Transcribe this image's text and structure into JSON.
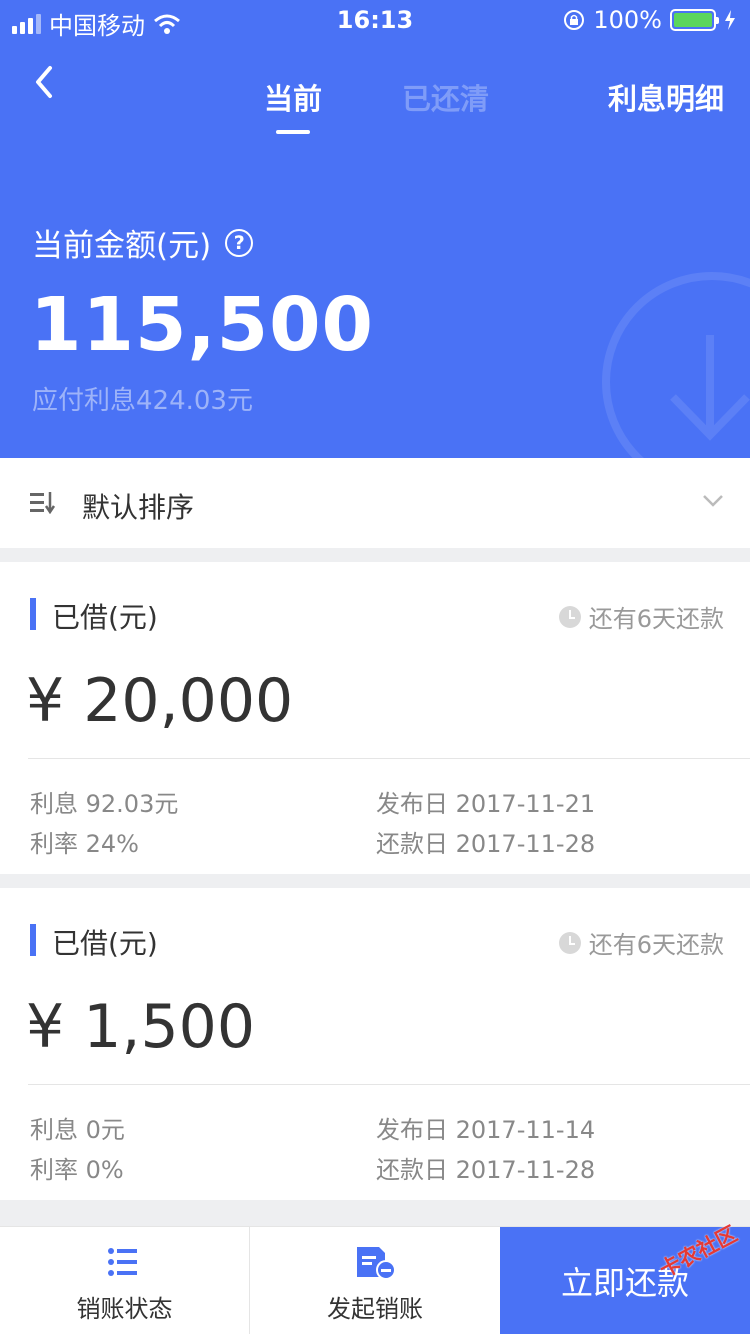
{
  "status_bar": {
    "carrier": "中国移动",
    "time": "16:13",
    "battery": "100%"
  },
  "nav": {
    "tabs": [
      "当前",
      "已还清"
    ],
    "right_label": "利息明细"
  },
  "summary": {
    "label": "当前金额(元)",
    "help_icon": "?",
    "amount": "115,500",
    "interest_due": "应付利息424.03元"
  },
  "sort": {
    "label": "默认排序"
  },
  "loans": [
    {
      "title": "已借(元)",
      "due": "还有6天还款",
      "amount": "¥ 20,000",
      "interest": "利息 92.03元",
      "rate": "利率 24%",
      "publish_date": "发布日 2017-11-21",
      "repay_date": "还款日 2017-11-28"
    },
    {
      "title": "已借(元)",
      "due": "还有6天还款",
      "amount": "¥ 1,500",
      "interest": "利息 0元",
      "rate": "利率 0%",
      "publish_date": "发布日 2017-11-14",
      "repay_date": "还款日 2017-11-28"
    }
  ],
  "bottom": {
    "status_label": "销账状态",
    "initiate_label": "发起销账",
    "repay_label": "立即还款"
  },
  "watermark": "卡农社区",
  "colors": {
    "primary": "#4a72f5",
    "background": "#eeeff1"
  }
}
